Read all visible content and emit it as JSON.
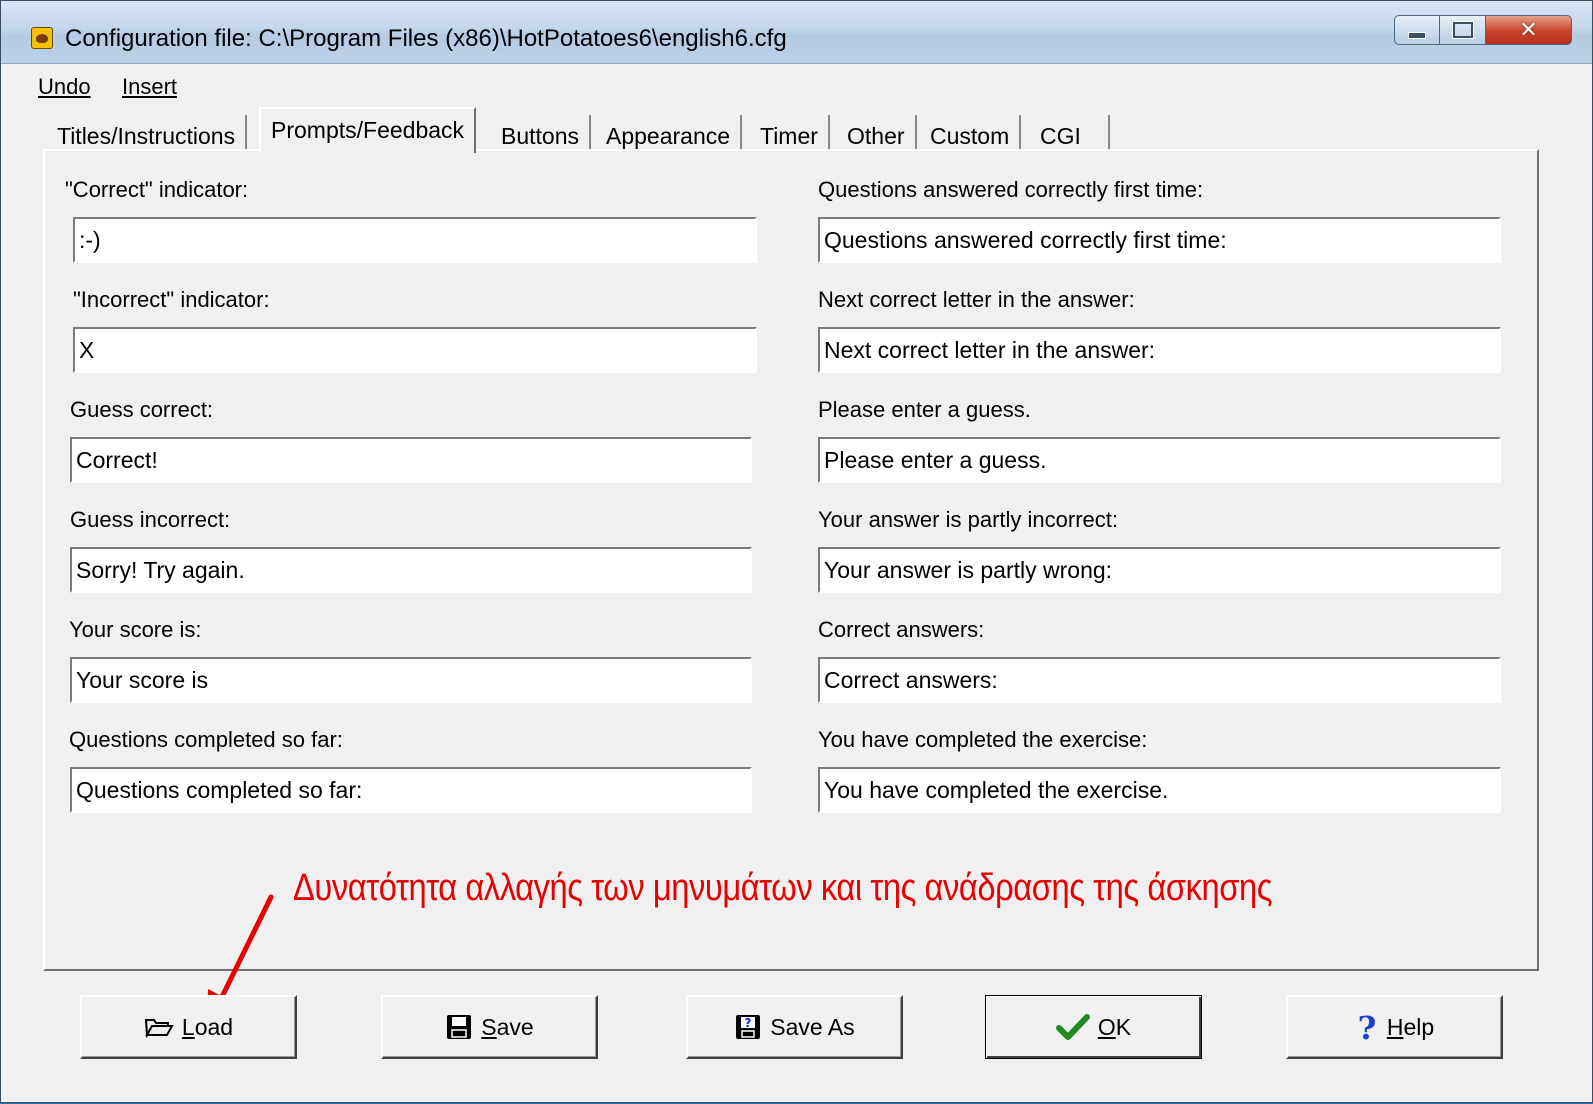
{
  "window": {
    "title": "Configuration file: C:\\Program Files (x86)\\HotPotatoes6\\english6.cfg"
  },
  "menu": {
    "undo_label": "Undo",
    "insert_label": "Insert"
  },
  "tabs": [
    {
      "label": "Titles/Instructions"
    },
    {
      "label": "Prompts/Feedback",
      "active": true
    },
    {
      "label": "Buttons"
    },
    {
      "label": "Appearance"
    },
    {
      "label": "Timer"
    },
    {
      "label": "Other"
    },
    {
      "label": "Custom"
    },
    {
      "label": "CGI"
    }
  ],
  "fields": {
    "left": [
      {
        "label": "\"Correct\" indicator:",
        "value": ":-)"
      },
      {
        "label": "\"Incorrect\" indicator:",
        "value": "X"
      },
      {
        "label": "Guess correct:",
        "value": "Correct!"
      },
      {
        "label": "Guess incorrect:",
        "value": "Sorry! Try again."
      },
      {
        "label": "Your score is:",
        "value": "Your score is"
      },
      {
        "label": "Questions completed so far:",
        "value": "Questions completed so far:"
      }
    ],
    "right": [
      {
        "label": "Questions answered correctly first time:",
        "value": "Questions answered correctly first time:"
      },
      {
        "label": "Next correct letter in the answer:",
        "value": "Next correct letter in the answer:"
      },
      {
        "label": "Please enter a guess.",
        "value": "Please enter a guess."
      },
      {
        "label": "Your answer is partly incorrect:",
        "value": "Your answer is partly wrong:"
      },
      {
        "label": "Correct answers:",
        "value": "Correct answers:"
      },
      {
        "label": "You have completed the exercise:",
        "value": "You have completed the exercise."
      }
    ]
  },
  "annotation": {
    "text": "Δυνατότητα αλλαγής των μηνυμάτων και της ανάδρασης της άσκησης",
    "color": "#e60000"
  },
  "buttons": {
    "load": "Load",
    "save": "Save",
    "save_as": "Save As",
    "ok": "OK",
    "help": "Help"
  },
  "icons": {
    "app": "hotpotatoes-icon",
    "load": "folder-open-icon",
    "save": "floppy-disk-icon",
    "save_as": "floppy-disk-question-icon",
    "ok": "checkmark-icon",
    "help": "question-mark-icon"
  }
}
